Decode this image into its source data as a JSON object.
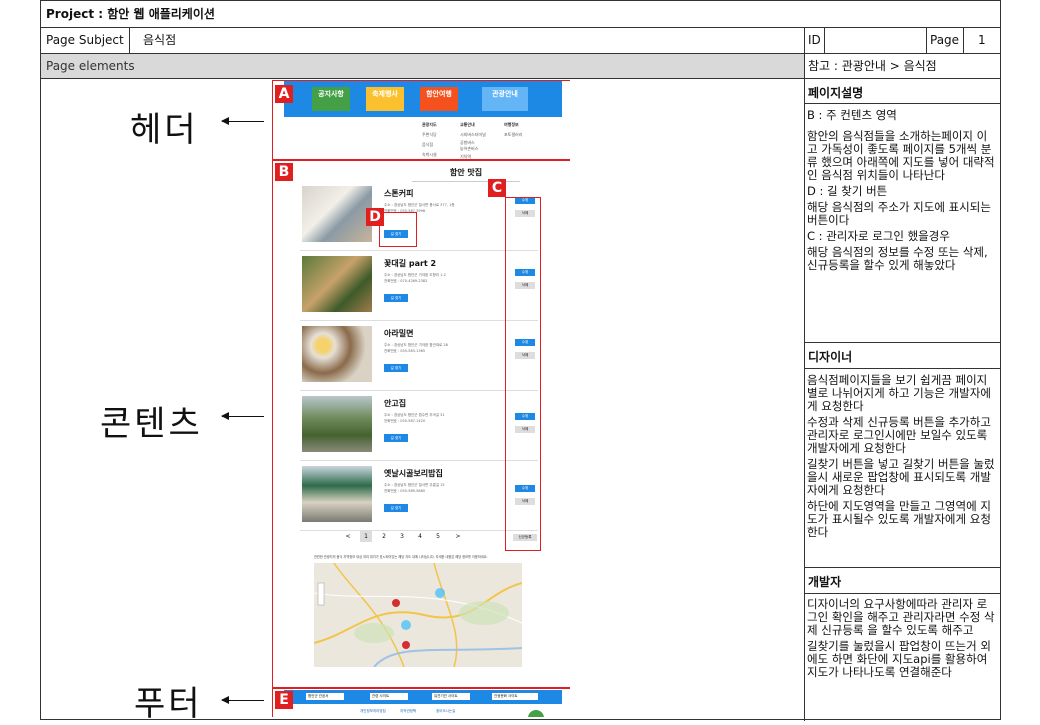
{
  "header": {
    "project": "Project : 함안 웹 애플리케이션",
    "page_subject_label": "Page Subject",
    "page_subject_value": "음식점",
    "id_label": "ID",
    "id_value": "",
    "page_label": "Page",
    "page_value": "1",
    "elements_label": "Page elements",
    "reference": "참고 : 관광안내 > 음식점"
  },
  "annotations": {
    "header": "헤더",
    "content": "콘텐츠",
    "footer": "푸터"
  },
  "tags": [
    "A",
    "B",
    "C",
    "D",
    "E"
  ],
  "sidebar": {
    "page_desc_title": "페이지설명",
    "page_desc": [
      "B : 주 컨텐츠 영역",
      "함안의 음식점들을 소개하는페이지 이고 가독성이 좋도록 페이지를 5개씩 분류 했으며 아래쪽에 지도를 넣어 대략적인 음식점 위치들이 나타난다",
      "D : 길 찾기 버튼",
      "해당 음식점의 주소가 지도에 표시되는 버튼이다",
      "C : 관리자로 로그인 했을경우",
      "해당 음식점의 정보를 수정 또는 삭제, 신규등록을 할수 있게 해놓았다"
    ],
    "designer_title": "디자이너",
    "designer": [
      "음식점페이지들을 보기 쉽게끔 페이지별로 나뉘어지게 하고 기능은 개발자에게 요청한다",
      "수정과 삭제 신규등록 버튼을 추가하고 관리자로 로그인시에만 보일수 있도록 개발자에게 요청한다",
      "길찾기 버튼을 넣고 길찾기 버튼을 눌렀을시 새로운 팝업창에 표시되도록 개발자에게 요청한다",
      "하단에 지도영역을 만들고 그영역에 지도가 표시될수 있도록 개발자에게 요청한다"
    ],
    "developer_title": "개발자",
    "developer": [
      "디자이너의 요구사항에따라 관리자 로그인 확인을 해주고 관리자라면 수정 삭제 신규등록 을 할수 있도록 해주고",
      "길찾기를 눌렀을시 팝업창이 뜨는거 외에도 하면 화단에 지도api를 활용하여 지도가 나타나도록 연결해준다"
    ]
  },
  "mockup": {
    "nav": [
      "공지사항",
      "축제행사",
      "함안여행",
      "관광안내"
    ],
    "nav_colors": [
      "#43a047",
      "#fbc02d",
      "#f4511e",
      "#1e88e5"
    ],
    "submenu": [
      [
        "관광지도",
        "주변식당",
        "음식점",
        "숙박시설"
      ],
      [
        "교통안내",
        "시외버스터미널",
        "공항버스",
        "농어촌버스",
        "기차역"
      ],
      [
        "여행정보",
        "포토갤러리"
      ]
    ],
    "section_title": "함안 맛집",
    "restaurants": [
      {
        "name": "스톤커피",
        "addr": "주소 : 경상남도 함안군 칠서면 용서로 377, 1층",
        "tel": "전화번호 : 055-587-3998"
      },
      {
        "name": "꽃대길 part 2",
        "addr": "주소 : 경상남도 함안군 가야읍 도항리 1-2",
        "tel": "전화번호 : 070-4269-2382"
      },
      {
        "name": "아라밀면",
        "addr": "주소 : 경상남도 함안군 가야읍 함안대로 28",
        "tel": "전화번호 : 055-583-1365"
      },
      {
        "name": "안고집",
        "addr": "주소 : 경상남도 함안군 법수면 추곡길 31",
        "tel": "전화번호 : 055-587-1420"
      },
      {
        "name": "옛날시골보리밥집",
        "addr": "주소 : 경상남도 함안군 칠서면 무릉길 15",
        "tel": "전화번호 : 055-589-5880"
      }
    ],
    "route_button": "길 찾기",
    "edit_button": "수정",
    "delete_button": "삭제",
    "new_button": "신규등록",
    "pages": [
      "<",
      "1",
      "2",
      "3",
      "4",
      "5",
      ">"
    ],
    "map_legend": "관련한 관광지의 음식 지역정보 대상  여러 위치가 표시되어있는 해당 지도 내에 나타납니다. 자세한 내용은 해당 정보를 이용하세요.",
    "footer_selects": [
      "함안군 관공서",
      "관련 사이트",
      "유관기관 사이트",
      "관광문화 사이트"
    ],
    "footer_links": [
      "개인정보처리방침",
      "저작권정책",
      "찾아오시는길"
    ]
  }
}
